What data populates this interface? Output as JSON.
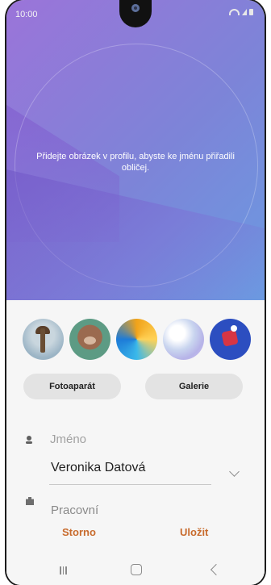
{
  "status_bar": {
    "time": "10:00"
  },
  "hero": {
    "hint_text": "Přidejte obrázek v profilu, abyste ke jménu přiřadili obličej."
  },
  "avatars": [
    "tree-avatar",
    "monkey-avatar",
    "abstract-avatar",
    "pastel-avatar",
    "blue-sticker-avatar"
  ],
  "buttons": {
    "camera": "Fotoaparát",
    "gallery": "Galerie"
  },
  "form": {
    "name_label": "Jméno",
    "name_value": "Veronika Datová",
    "work_label": "Pracovní"
  },
  "actions": {
    "cancel": "Storno",
    "save": "Uložit"
  }
}
